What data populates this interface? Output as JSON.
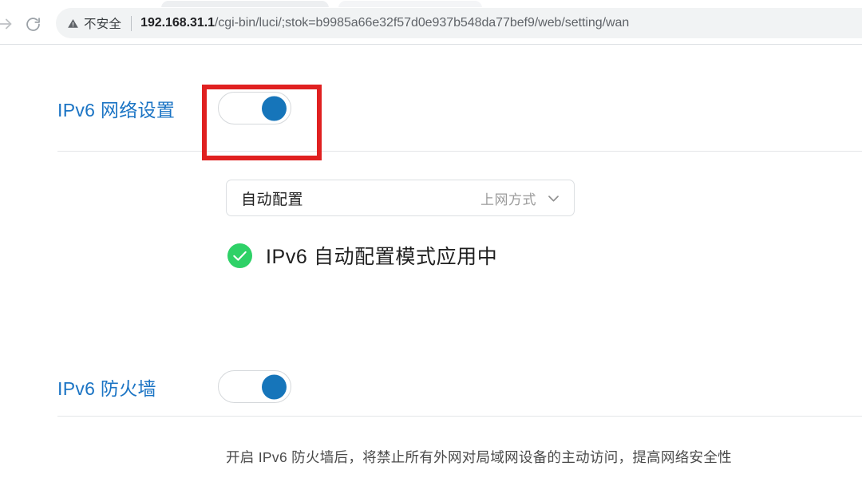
{
  "browser": {
    "forward_icon": "arrow-forward-icon",
    "reload_icon": "reload-icon",
    "security": {
      "icon": "warning-triangle-icon",
      "label": "不安全"
    },
    "url": {
      "host": "192.168.31.1",
      "path": "/cgi-bin/luci/;stok=b9985a66e32f57d0e937b548da77bef9/web/setting/wan"
    }
  },
  "page": {
    "sections": [
      {
        "title": "IPv6 网络设置",
        "toggle": {
          "name": "ipv6-network-toggle",
          "state": "on"
        }
      },
      {
        "title": "IPv6 防火墙",
        "toggle": {
          "name": "ipv6-firewall-toggle",
          "state": "on"
        }
      }
    ],
    "connection_type": {
      "value": "自动配置",
      "hint": "上网方式",
      "chevron_icon": "chevron-down-icon"
    },
    "status": {
      "icon": "check-circle-icon",
      "text": "IPv6 自动配置模式应用中"
    },
    "firewall_description": "开启 IPv6 防火墙后，将禁止所有外网对局域网设备的主动访问，提高网络安全性"
  },
  "annotation": {
    "name": "red-highlight-box",
    "color": "#e02020"
  },
  "colors": {
    "heading_blue": "#1b74c4",
    "toggle_knob_blue": "#1675ba",
    "status_green": "#2ed167",
    "annotation_red": "#e02020"
  }
}
